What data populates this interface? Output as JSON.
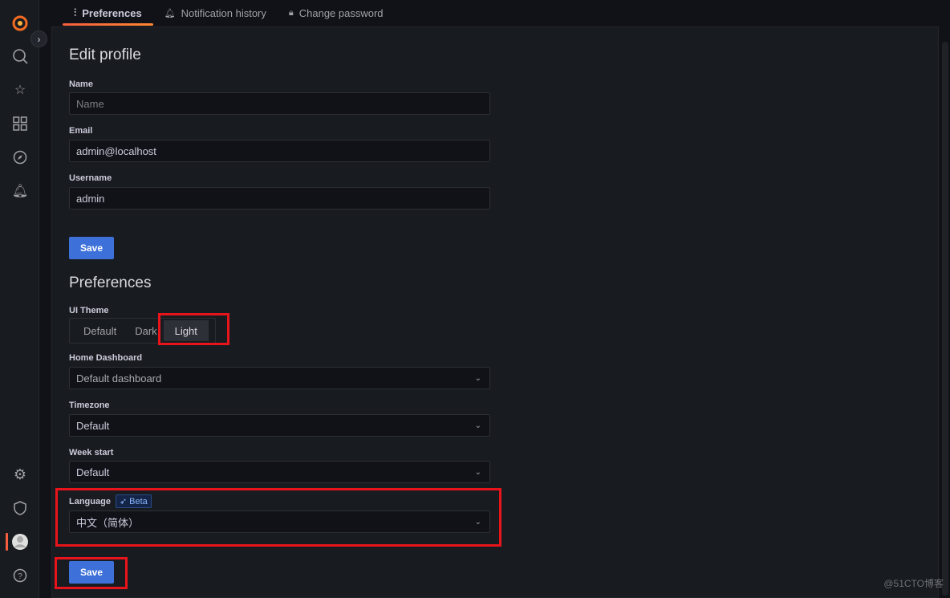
{
  "sidebar": {
    "icons": [
      "grafana-logo-icon",
      "search-icon",
      "star-icon",
      "dashboards-icon",
      "explore-icon",
      "alerting-icon",
      "configuration-icon",
      "shield-icon",
      "avatar",
      "help-icon"
    ]
  },
  "tabs": [
    {
      "label": "Preferences",
      "icon": "sliders-icon",
      "active": true
    },
    {
      "label": "Notification history",
      "icon": "bell-icon"
    },
    {
      "label": "Change password",
      "icon": "lock-icon"
    }
  ],
  "edit_profile": {
    "title": "Edit profile",
    "name_label": "Name",
    "name_placeholder": "Name",
    "email_label": "Email",
    "email_value": "admin@localhost",
    "username_label": "Username",
    "username_value": "admin",
    "save": "Save"
  },
  "preferences": {
    "title": "Preferences",
    "theme_label": "UI Theme",
    "theme_options": [
      "Default",
      "Dark",
      "Light"
    ],
    "theme_selected": "Light",
    "home_label": "Home Dashboard",
    "home_value": "Default dashboard",
    "tz_label": "Timezone",
    "tz_value": "Default",
    "week_label": "Week start",
    "week_value": "Default",
    "lang_label": "Language",
    "lang_badge": "Beta",
    "lang_value": "中文（简体）",
    "save": "Save"
  },
  "watermark": "@51CTO博客",
  "colors": {
    "accent": "#3d71d9",
    "tab_underline": "#f55f3e",
    "annotation": "#e8141c"
  }
}
